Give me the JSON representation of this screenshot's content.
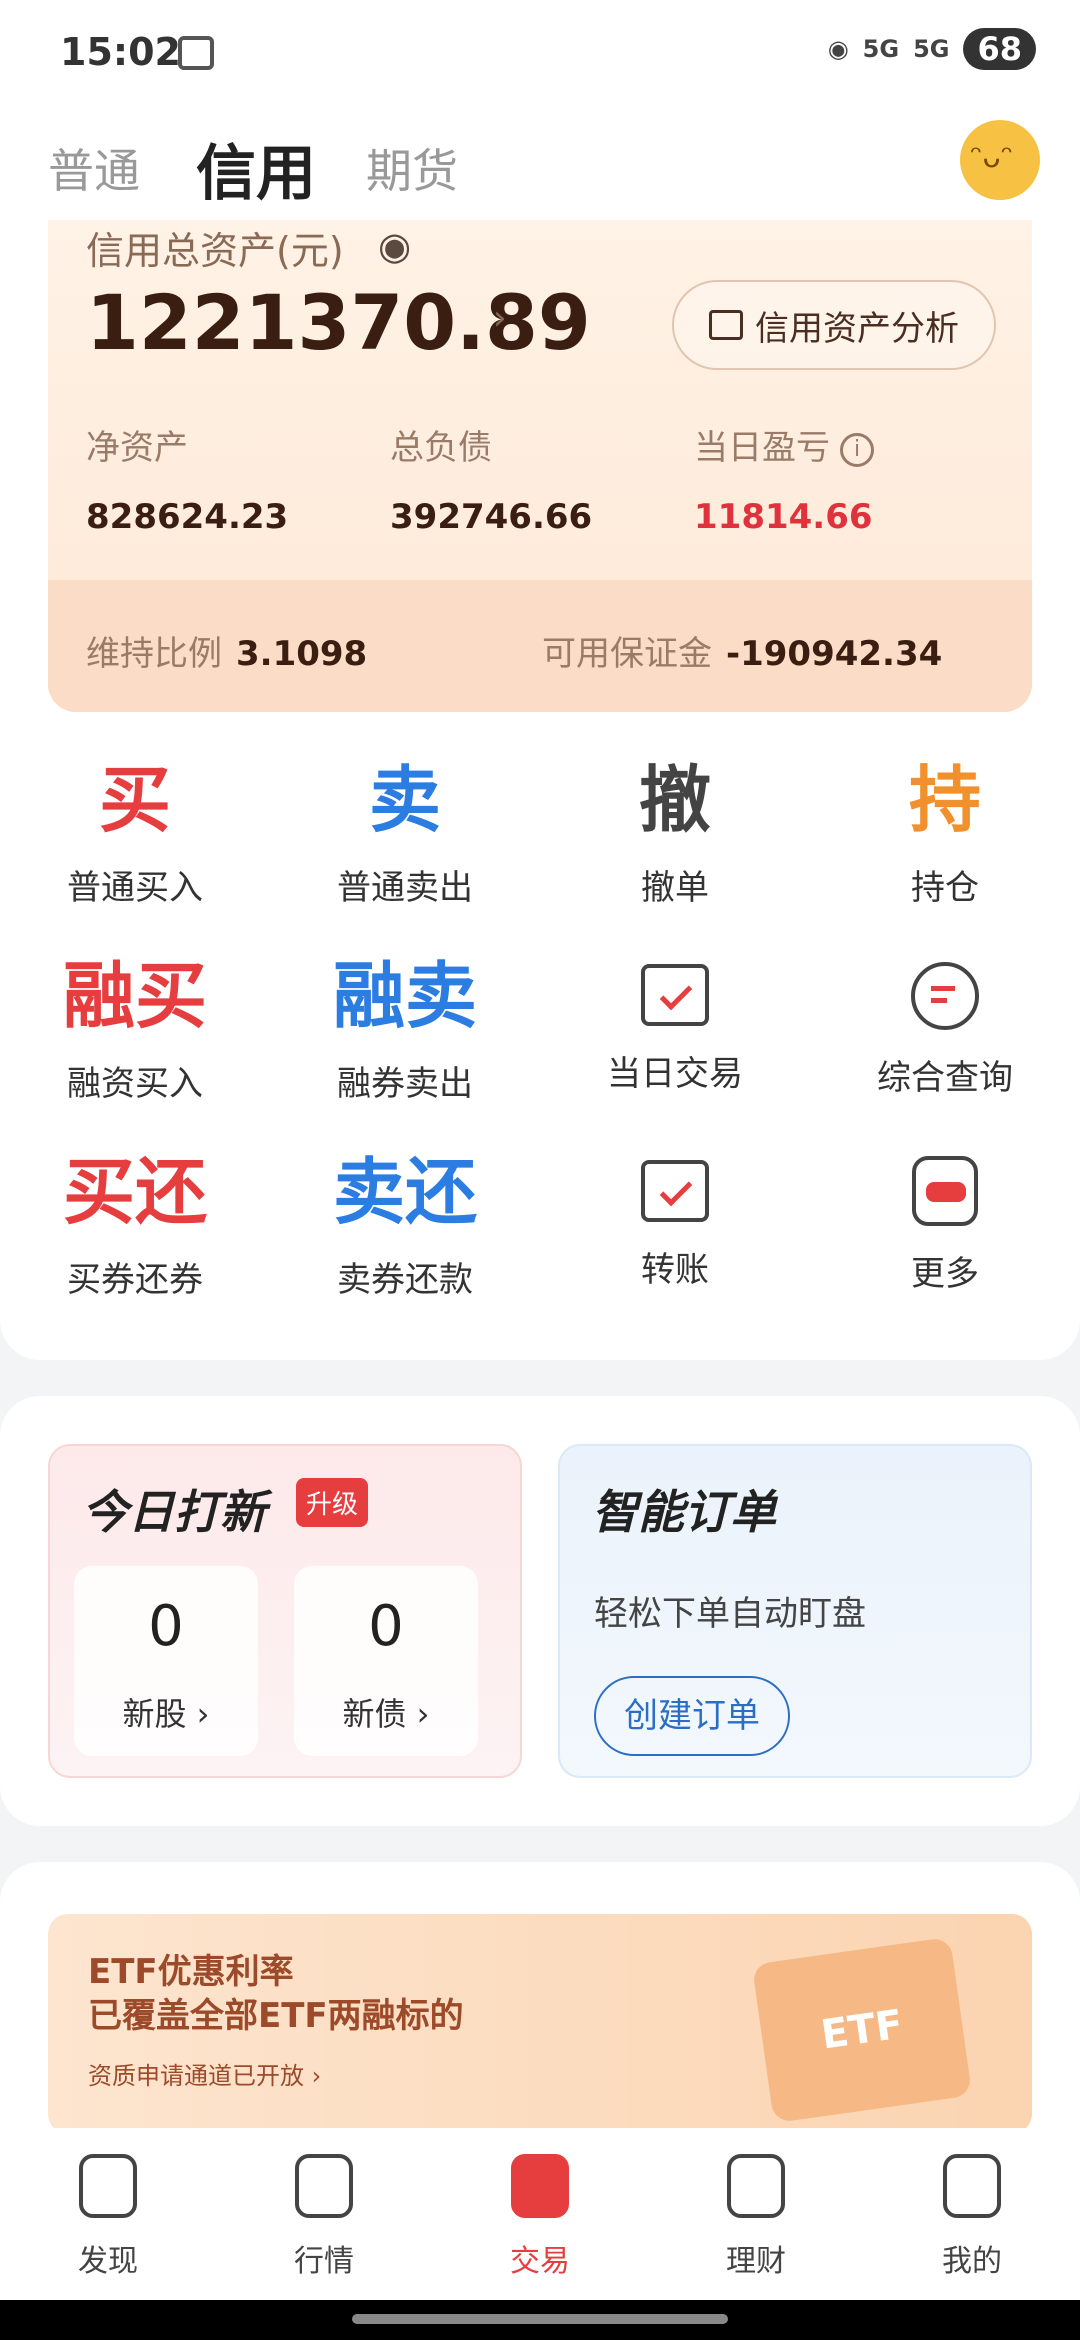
{
  "status": {
    "time": "15:02",
    "network": "5G",
    "battery": "68"
  },
  "tabs": [
    "普通",
    "信用",
    "期货"
  ],
  "asset": {
    "title": "信用总资产(元)",
    "total": "1221370.89",
    "analysis": "信用资产分析",
    "net_label": "净资产",
    "net_value": "828624.23",
    "debt_label": "总负债",
    "debt_value": "392746.66",
    "pnl_label": "当日盈亏",
    "pnl_value": "11814.66",
    "maint_label": "维持比例",
    "maint_value": "3.1098",
    "margin_label": "可用保证金",
    "margin_value": "-190942.34"
  },
  "actions": [
    {
      "glyph": "买",
      "label": "普通买入"
    },
    {
      "glyph": "卖",
      "label": "普通卖出"
    },
    {
      "glyph": "撤",
      "label": "撤单"
    },
    {
      "glyph": "持",
      "label": "持仓"
    },
    {
      "glyph": "融买",
      "label": "融资买入"
    },
    {
      "glyph": "融卖",
      "label": "融券卖出"
    },
    {
      "label": "当日交易"
    },
    {
      "label": "综合查询"
    },
    {
      "glyph": "买还",
      "label": "买券还券"
    },
    {
      "glyph": "卖还",
      "label": "卖券还款"
    },
    {
      "label": "转账"
    },
    {
      "label": "更多"
    }
  ],
  "ipo": {
    "title": "今日打新",
    "badge": "升级",
    "stock_count": "0",
    "stock_label": "新股 ›",
    "bond_count": "0",
    "bond_label": "新债 ›"
  },
  "smart_order": {
    "title": "智能订单",
    "desc": "轻松下单自动盯盘",
    "button": "创建订单"
  },
  "banner": {
    "line1": "ETF优惠利率",
    "line2": "已覆盖全部ETF两融标的",
    "sub": "资质申请通道已开放 ›",
    "tag": "ETF"
  },
  "nav": [
    "发现",
    "行情",
    "交易",
    "理财",
    "我的"
  ]
}
